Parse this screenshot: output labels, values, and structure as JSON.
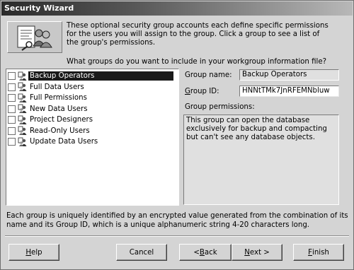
{
  "window": {
    "title": "Security Wizard"
  },
  "intro_text": "These optional security group accounts each define specific permissions for the users you will assign to the group. Click a group to see a list of the group's permissions.",
  "question_text": "What groups do you want to include in your workgroup information file?",
  "groups": [
    {
      "label": "Backup Operators",
      "checked": false,
      "selected": true
    },
    {
      "label": "Full Data Users",
      "checked": false,
      "selected": false
    },
    {
      "label": "Full Permissions",
      "checked": false,
      "selected": false
    },
    {
      "label": "New Data Users",
      "checked": false,
      "selected": false
    },
    {
      "label": "Project Designers",
      "checked": false,
      "selected": false
    },
    {
      "label": "Read-Only Users",
      "checked": false,
      "selected": false
    },
    {
      "label": "Update Data Users",
      "checked": false,
      "selected": false
    }
  ],
  "details": {
    "group_name_label": "Group name:",
    "group_name_value": "Backup Operators",
    "group_id_label_pre": "",
    "group_id_label_accel": "G",
    "group_id_label_post": "roup ID:",
    "group_id_value": "HNNtTMk7JnRFEMNbluw",
    "permissions_label": "Group permissions:",
    "permissions_text": "This group can open the database exclusively for backup and compacting but can't see any database objects."
  },
  "footer_note": "Each group is uniquely identified by an encrypted value generated from the combination of its name and its Group ID, which is a unique alphanumeric string 4-20 characters long.",
  "buttons": {
    "help_accel": "H",
    "help_rest": "elp",
    "cancel": "Cancel",
    "back_pre": "< ",
    "back_accel": "B",
    "back_rest": "ack",
    "next_accel": "N",
    "next_rest": "ext >",
    "finish_accel": "F",
    "finish_rest": "inish"
  },
  "icons": {
    "wizard": "security-wizard-icon",
    "group": "group-users-icon"
  }
}
